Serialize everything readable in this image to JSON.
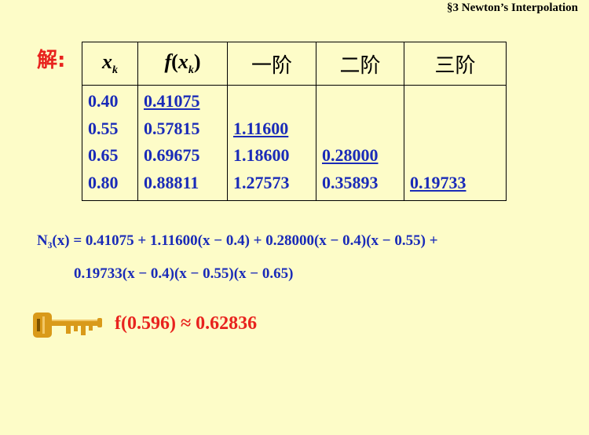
{
  "header": "§3  Newton’s Interpolation",
  "solution_label": "解:",
  "table": {
    "headers": {
      "x_base": "x",
      "x_sub": "k",
      "f_name": "f",
      "f_open": "(",
      "f_x": "x",
      "f_sub": "k",
      "f_close": ")",
      "order1": "一阶",
      "order2": "二阶",
      "order3": "三阶"
    },
    "x": [
      "0.40",
      "0.55",
      "0.65",
      "0.80"
    ],
    "fx": [
      "0.41075",
      "0.57815",
      "0.69675",
      "0.88811"
    ],
    "order1": [
      "",
      "1.11600",
      "1.18600",
      "1.27573"
    ],
    "order2": [
      "",
      "",
      "0.28000",
      "0.35893"
    ],
    "order3": [
      "",
      "",
      "",
      "0.19733"
    ]
  },
  "formula": {
    "line1": "N₃(x) = 0.41075 + 1.11600(x − 0.4) + 0.28000(x − 0.4)(x − 0.55) +",
    "line2": "0.19733(x − 0.4)(x − 0.55)(x − 0.65)"
  },
  "result": "f(0.596) ≈ 0.62836",
  "colors": {
    "background": "#fdfcc8",
    "red": "#e8231e",
    "blue": "#1a2bb8",
    "key": "#d99a1a"
  },
  "icons": [
    "key-icon"
  ]
}
